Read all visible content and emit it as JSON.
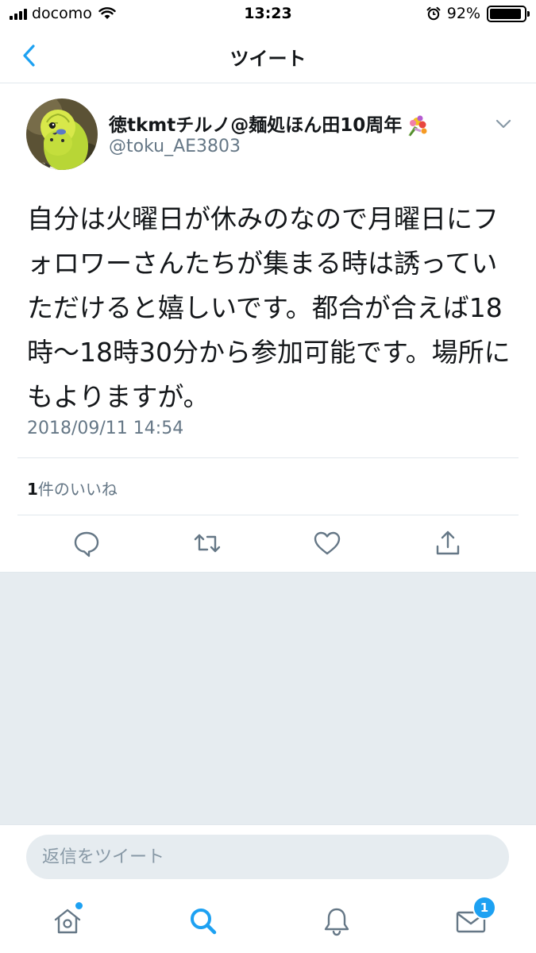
{
  "status_bar": {
    "carrier": "docomo",
    "time": "13:23",
    "battery_percent": "92%",
    "battery_level": 0.92
  },
  "nav": {
    "title": "ツイート",
    "back_icon": "chevron-left-icon"
  },
  "tweet": {
    "display_name": "徳tkmtチルノ@麺処ほん田10周年",
    "name_emoji_icon": "bouquet-icon",
    "username": "@toku_AE3803",
    "text": "自分は火曜日が休みのなので月曜日にフォロワーさんたちが集まる時は誘っていただけると嬉しいです。都合が合えば18時〜18時30分から参加可能です。場所にもよりますが。",
    "timestamp": "2018/09/11 14:54",
    "likes_count": "1",
    "likes_label": "件のいいね"
  },
  "actions": [
    {
      "name": "reply",
      "icon": "reply-icon"
    },
    {
      "name": "retweet",
      "icon": "retweet-icon"
    },
    {
      "name": "like",
      "icon": "heart-icon"
    },
    {
      "name": "share",
      "icon": "share-icon"
    }
  ],
  "reply": {
    "placeholder": "返信をツイート"
  },
  "tabs": [
    {
      "name": "home",
      "icon": "home-icon",
      "active": false,
      "has_dot": true
    },
    {
      "name": "search",
      "icon": "search-icon",
      "active": true
    },
    {
      "name": "notifications",
      "icon": "bell-icon",
      "active": false
    },
    {
      "name": "messages",
      "icon": "envelope-icon",
      "active": false,
      "badge": "1"
    }
  ],
  "colors": {
    "accent": "#1da1f2",
    "text": "#14171a",
    "secondary": "#657786",
    "icon": "#657786",
    "separator": "#e1e8ed",
    "background_gray": "#e6ecf0"
  }
}
